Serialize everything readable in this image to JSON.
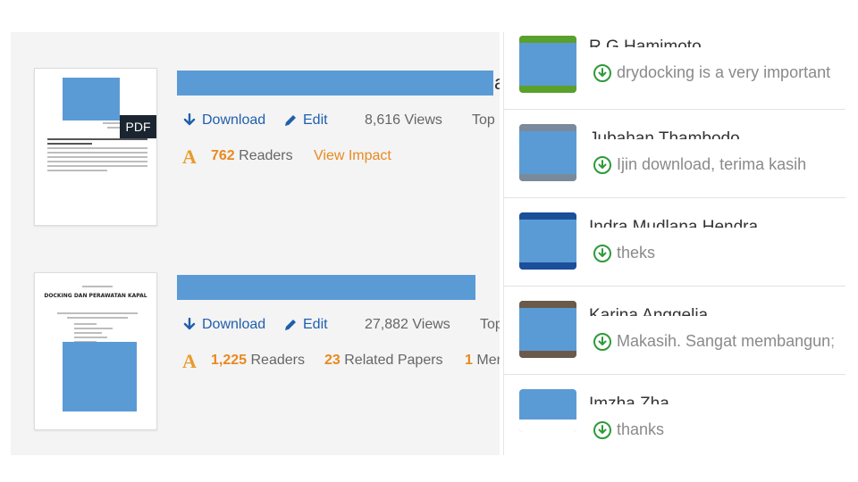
{
  "papers": [
    {
      "title_overflow": "a",
      "thumb_pdf_badge": "PDF",
      "download_label": "Download",
      "edit_label": "Edit",
      "views": "8,616 Views",
      "tab_truncated": "Top",
      "readers_count": "762",
      "readers_label": "Readers",
      "view_impact_label": "View Impact"
    },
    {
      "thumb_title": "DOCKING DAN PERAWATAN KAPAL",
      "download_label": "Download",
      "edit_label": "Edit",
      "views": "27,882 Views",
      "tab_truncated": "Top",
      "readers_count": "1,225",
      "readers_label": "Readers",
      "related_count": "23",
      "related_label": "Related Papers",
      "mentions_count": "1",
      "mentions_label": "Men"
    }
  ],
  "comments": [
    {
      "name": "R.G Hamimoto",
      "message": "drydocking is a very important",
      "accent": "#5aa02c"
    },
    {
      "name": "Jubahan Thambodo",
      "message": "Ijin download, terima kasih",
      "accent": "#7b8a9a"
    },
    {
      "name": "Indra Mudlana Hendra",
      "message": "theks",
      "accent": "#1a4f9a"
    },
    {
      "name": "Karina Anggelia",
      "message": "Makasih. Sangat membangun;",
      "accent": "#6a5a4a"
    },
    {
      "name": "Imzha Zha",
      "message": "thanks",
      "accent": "#ffffff"
    }
  ],
  "colors": {
    "link_blue": "#1f5fad",
    "orange": "#e8891f",
    "green": "#2e9a3a",
    "redaction": "#5b9bd5"
  },
  "icons": [
    "download-arrow-icon",
    "pencil-icon",
    "readers-a-icon",
    "download-circle-icon",
    "pdf-badge-icon"
  ]
}
